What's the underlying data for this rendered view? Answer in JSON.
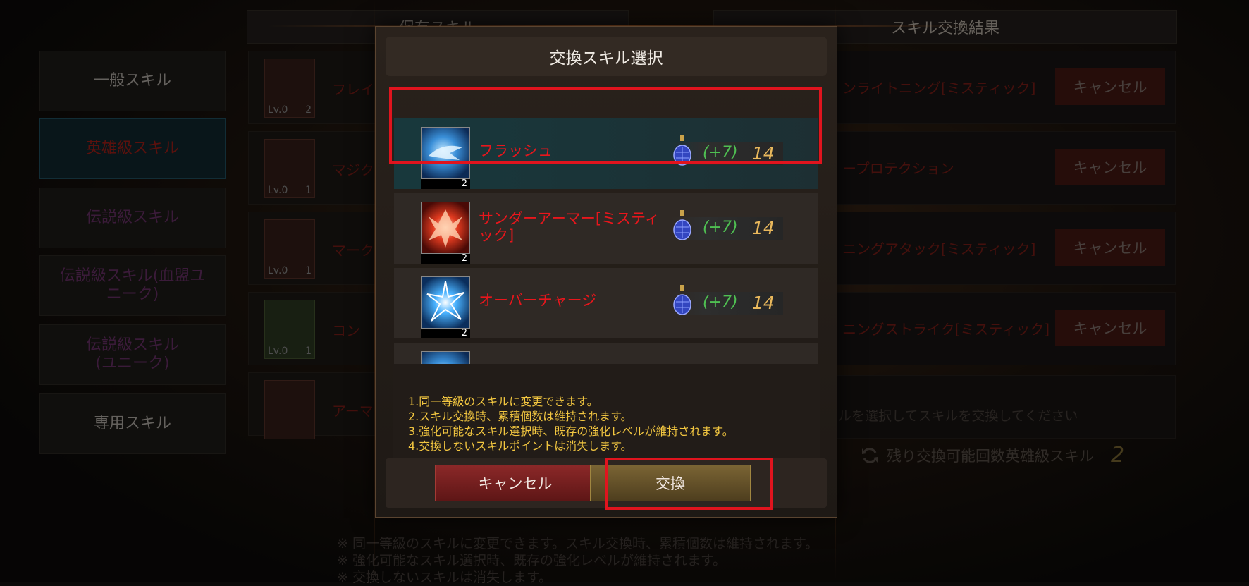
{
  "background": {
    "tabs": {
      "owned": "保有スキル",
      "result": "スキル交換結果"
    },
    "categories": [
      {
        "label": "一般スキル"
      },
      {
        "label": "英雄級スキル"
      },
      {
        "label": "伝説級スキル"
      },
      {
        "label": "伝説級スキル(血盟ユニーク)"
      },
      {
        "label": "伝説級スキル(ユニーク)"
      },
      {
        "label": "専用スキル"
      }
    ],
    "owned_skills": [
      {
        "name": "フレイ",
        "level": "Lv.0",
        "count": "2"
      },
      {
        "name": "マジク",
        "level": "Lv.0",
        "count": "1"
      },
      {
        "name": "マーク",
        "level": "Lv.0",
        "count": "1"
      },
      {
        "name": "コン",
        "level": "Lv.0",
        "count": "1"
      },
      {
        "name": "アーマ",
        "level": "",
        "count": ""
      }
    ],
    "results": [
      {
        "name": "ンライトニング[ミスティック]",
        "cancel": "キャンセル"
      },
      {
        "name": "ープロテクション",
        "cancel": "キャンセル"
      },
      {
        "name": "ニングアタック[ミスティック]",
        "cancel": "キャンセル"
      },
      {
        "name": "ニングストライク[ミスティック]",
        "cancel": "キャンセル"
      }
    ],
    "result_hint": "ルを選択してスキルを交換してください",
    "remaining_label": "残り交換可能回数英雄級スキル",
    "remaining_count": "2",
    "notes": [
      "※  同一等級のスキルに変更できます。スキル交換時、累積個数は維持されます。",
      "※  強化可能なスキル選択時、既存の強化レベルが維持されます。",
      "※  交換しないスキルは消失します。"
    ]
  },
  "modal": {
    "title": "交換スキル選択",
    "skills": [
      {
        "name": "フラッシュ",
        "count": "2",
        "bonus": "(+7)",
        "cost": "14",
        "icon": "flash-skill-icon",
        "selected": true
      },
      {
        "name": "サンダーアーマー[ミスティック]",
        "count": "2",
        "bonus": "(+7)",
        "cost": "14",
        "icon": "thunder-armor-skill-icon",
        "selected": false
      },
      {
        "name": "オーバーチャージ",
        "count": "2",
        "bonus": "(+7)",
        "cost": "14",
        "icon": "overcharge-skill-icon",
        "selected": false
      },
      {
        "name": "",
        "count": "",
        "bonus": "",
        "cost": "",
        "icon": "partial-skill-icon",
        "selected": false
      }
    ],
    "rules": [
      "1.同一等級のスキルに変更できます。",
      "2.スキル交換時、累積個数は維持されます。",
      "3.強化可能なスキル選択時、既存の強化レベルが維持されます。",
      "4.交換しないスキルポイントは消失します。"
    ],
    "cancel_label": "キャンセル",
    "exchange_label": "交換"
  },
  "colors": {
    "highlight": "#e0141e",
    "skill_name": "#e8161c",
    "bonus": "#4fbf52",
    "cost": "#e9b85c",
    "rules_text": "#f2c640"
  }
}
